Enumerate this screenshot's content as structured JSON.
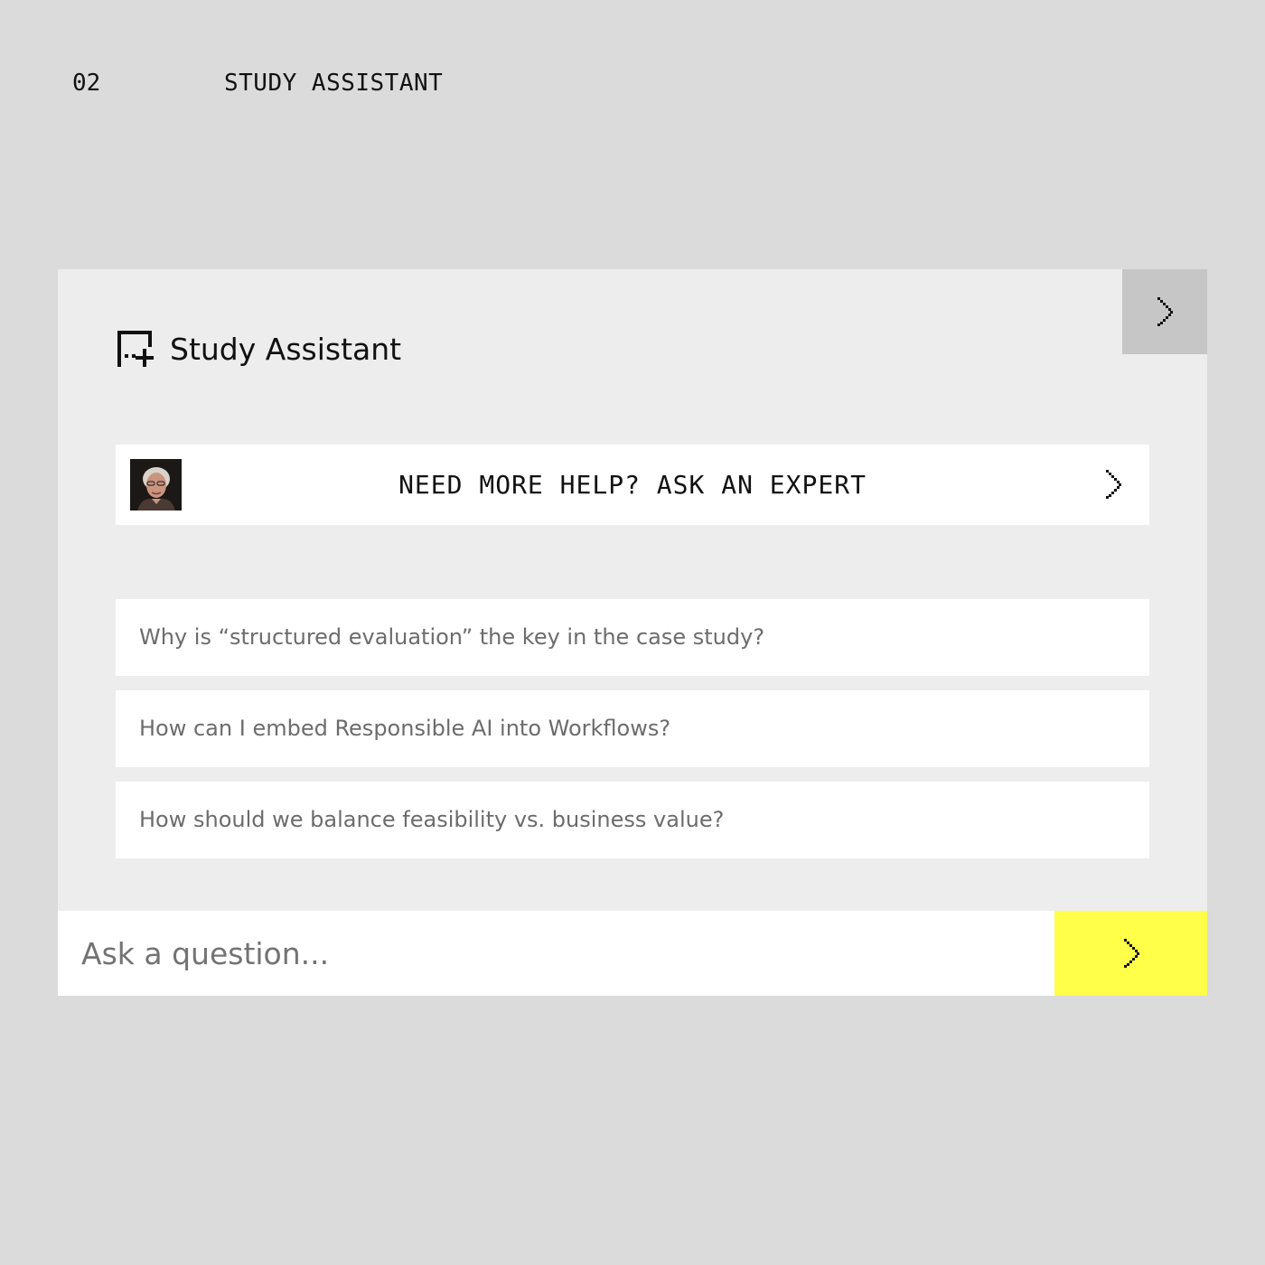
{
  "section": {
    "number": "02",
    "title": "STUDY ASSISTANT"
  },
  "panel": {
    "title": "Study Assistant",
    "icons": {
      "assistant": "chat-plus-icon",
      "collapse": "chevron-right-icon",
      "expert_arrow": "chevron-right-icon",
      "send": "chevron-right-icon"
    },
    "expert_banner": {
      "label": "NEED MORE HELP? ASK AN EXPERT",
      "avatar": "expert-portrait"
    },
    "suggestions": [
      {
        "text": "Why is “structured evaluation” the key in the case study?"
      },
      {
        "text": "How can I embed Responsible AI into Workflows?"
      },
      {
        "text": "How should we balance feasibility vs. business value?"
      }
    ],
    "input": {
      "placeholder": "Ask a question...",
      "value": ""
    }
  },
  "colors": {
    "page_background": "#dbdbdb",
    "panel_background": "#ededee",
    "collapse_button": "#c6c6c6",
    "send_button": "#ffff4a",
    "card_background": "#ffffff",
    "suggestion_text": "#6c6c6c"
  }
}
